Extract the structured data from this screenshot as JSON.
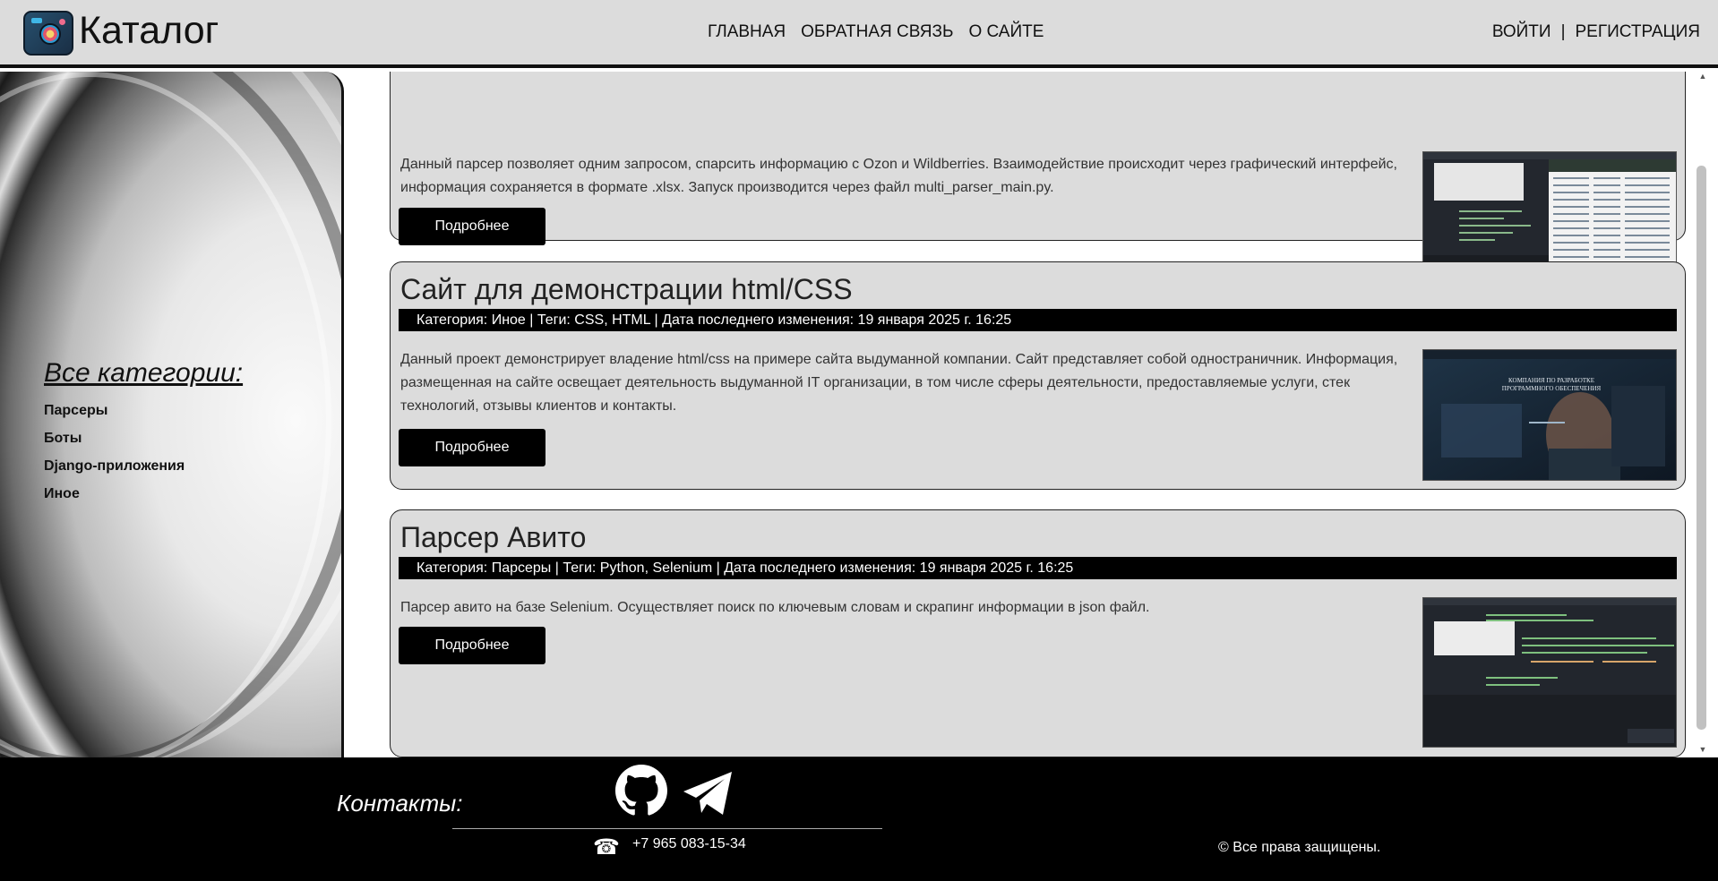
{
  "header": {
    "brand": "Каталог",
    "nav": [
      "ГЛАВНАЯ",
      "ОБРАТНАЯ СВЯЗЬ",
      "О САЙТЕ"
    ],
    "login": "ВОЙТИ",
    "separator": "|",
    "register": "РЕГИСТРАЦИЯ"
  },
  "sidebar": {
    "title": "Все категории:",
    "categories": [
      "Парсеры",
      "Боты",
      "Django-приложения",
      "Иное"
    ]
  },
  "cards": [
    {
      "title": "",
      "meta": "",
      "description": "Данный парсер позволяет одним запросом, спарсить информацию с Ozon и Wildberries. Взаимодействие происходит через графический интерфейс, информация сохраняется в формате .xlsx. Запуск производится через файл multi_parser_main.py.",
      "button": "Подробнее"
    },
    {
      "title": "Сайт для демонстрации html/CSS",
      "meta": "Категория: Иное | Теги: CSS, HTML | Дата последнего изменения: 19 января 2025 г. 16:25",
      "description": "Данный проект демонстрирует владение html/css на примере сайта выдуманной компании. Сайт представляет собой одностраничник. Информация, размещенная на сайте освещает деятельность выдуманной IT организации, в том числе сферы деятельности, предоставляемые услуги, стек технологий, отзывы клиентов и контакты.",
      "button": "Подробнее",
      "thumb_text": "КОМПАНИЯ ПО РАЗРАБОТКЕ ПРОГРАММНОГО ОБЕСПЕЧЕНИЯ"
    },
    {
      "title": "Парсер Авито",
      "meta": "Категория: Парсеры | Теги: Python, Selenium | Дата последнего изменения: 19 января 2025 г. 16:25",
      "description": "Парсер авито на базе Selenium. Осуществляет поиск по ключевым словам и скрапинг информации в json файл.",
      "button": "Подробнее"
    }
  ],
  "footer": {
    "contacts_label": "Контакты:",
    "phone": "+7 965 083-15-34",
    "copyright": "© Все права защищены."
  }
}
